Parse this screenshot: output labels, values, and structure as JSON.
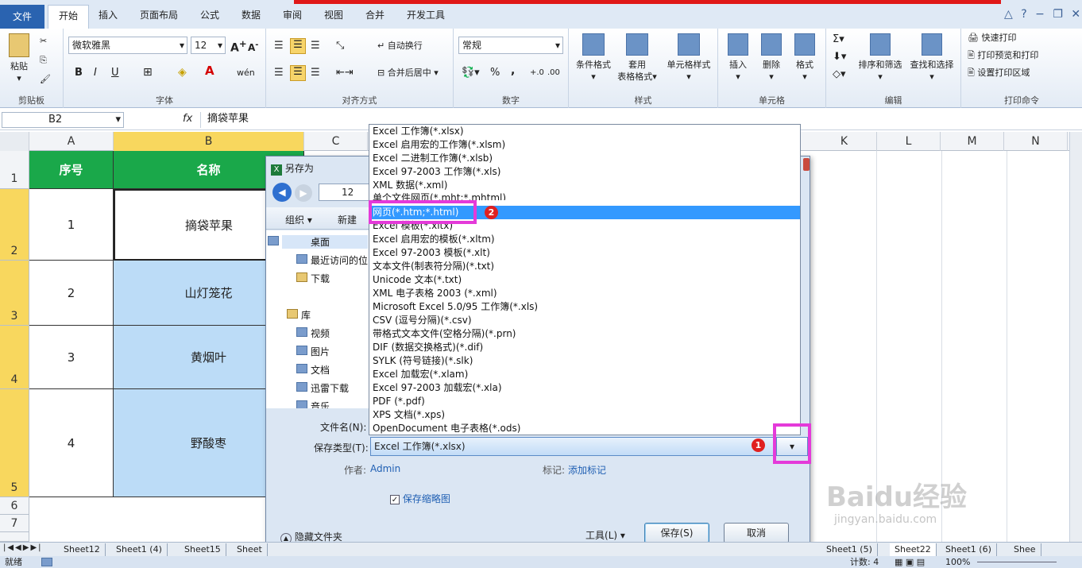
{
  "ribbon": {
    "tabs": [
      {
        "label": "文件"
      },
      {
        "label": "开始"
      },
      {
        "label": "插入"
      },
      {
        "label": "页面布局"
      },
      {
        "label": "公式"
      },
      {
        "label": "数据"
      },
      {
        "label": "审阅"
      },
      {
        "label": "视图"
      },
      {
        "label": "合并"
      },
      {
        "label": "开发工具"
      }
    ],
    "groups": {
      "clipboard": "剪贴板",
      "font": "字体",
      "align": "对齐方式",
      "number": "数字",
      "styles": "样式",
      "cells": "单元格",
      "edit": "编辑",
      "print": "打印命令"
    },
    "paste": "粘贴",
    "font_name": "微软雅黑",
    "font_size": "12",
    "wrap": "自动换行",
    "merge": "合并后居中",
    "number_format": "常规",
    "cond": "条件格式",
    "table1": "套用",
    "table2": "表格格式",
    "cellstyle": "单元格样式",
    "insert": "插入",
    "delete": "删除",
    "format": "格式",
    "sort": "排序和筛选",
    "find": "查找和选择",
    "print_quick": "快速打印",
    "print_preview": "打印预览和打印",
    "print_area": "设置打印区域",
    "bold": "B",
    "italic": "I",
    "underline": "U",
    "percent": "%",
    "comma": ","
  },
  "formula_bar": {
    "name_box": "B2",
    "fx": "fx",
    "value": "摘袋苹果"
  },
  "columns": {
    "A": "A",
    "B": "B",
    "C": "C",
    "K": "K",
    "L": "L",
    "M": "M",
    "N": "N"
  },
  "rows": [
    "1",
    "2",
    "3",
    "4",
    "5",
    "6",
    "7"
  ],
  "table": {
    "header_no": "序号",
    "header_name": "名称",
    "rows": [
      {
        "no": "1",
        "name": "摘袋苹果"
      },
      {
        "no": "2",
        "name": "山灯笼花"
      },
      {
        "no": "3",
        "name": "黄烟叶"
      },
      {
        "no": "4",
        "name": "野酸枣"
      }
    ]
  },
  "sheet_tabs_left": [
    "Sheet12",
    "Sheet1 (4)",
    "Sheet15",
    "Sheet"
  ],
  "sheet_tabs_right": [
    "Sheet1 (5)",
    "Sheet22",
    "Sheet1 (6)",
    "Shee"
  ],
  "status": {
    "ready": "就绪",
    "count": "计数: 4",
    "zoom": "100%"
  },
  "dialog": {
    "title": "另存为",
    "path_part": "12",
    "organize": "组织 ▾",
    "new_folder": "新建",
    "nav": [
      "桌面",
      "最近访问的位",
      "下载",
      "库",
      "视频",
      "图片",
      "文档",
      "迅雷下载",
      "音乐"
    ],
    "filename_label": "文件名(N):",
    "savetype_label": "保存类型(T):",
    "savetype_value": "Excel 工作簿(*.xlsx)",
    "author_label": "作者:",
    "author_value": "Admin",
    "tags_label": "标记:",
    "tags_value": "添加标记",
    "thumbnail": "保存缩略图",
    "hide_folders": "隐藏文件夹",
    "tools": "工具(L)",
    "save": "保存(S)",
    "cancel": "取消"
  },
  "filetypes": [
    "Excel 工作簿(*.xlsx)",
    "Excel 启用宏的工作簿(*.xlsm)",
    "Excel 二进制工作簿(*.xlsb)",
    "Excel 97-2003 工作簿(*.xls)",
    "XML 数据(*.xml)",
    "单个文件网页(*.mht;*.mhtml)",
    "网页(*.htm;*.html)",
    "Excel 模板(*.xltx)",
    "Excel 启用宏的模板(*.xltm)",
    "Excel 97-2003 模板(*.xlt)",
    "文本文件(制表符分隔)(*.txt)",
    "Unicode 文本(*.txt)",
    "XML 电子表格 2003 (*.xml)",
    "Microsoft Excel 5.0/95 工作簿(*.xls)",
    "CSV (逗号分隔)(*.csv)",
    "带格式文本文件(空格分隔)(*.prn)",
    "DIF (数据交换格式)(*.dif)",
    "SYLK (符号链接)(*.slk)",
    "Excel 加载宏(*.xlam)",
    "Excel 97-2003 加载宏(*.xla)",
    "PDF (*.pdf)",
    "XPS 文档(*.xps)",
    "OpenDocument 电子表格(*.ods)"
  ],
  "badges": {
    "one": "1",
    "two": "2"
  },
  "watermark": {
    "brand": "Baidu经验",
    "url": "jingyan.baidu.com"
  },
  "colors": {
    "header_green": "#1aa84a",
    "selected_blue": "#bcdcf7",
    "highlight": "#3399ff",
    "magenta": "#e43ad9"
  }
}
